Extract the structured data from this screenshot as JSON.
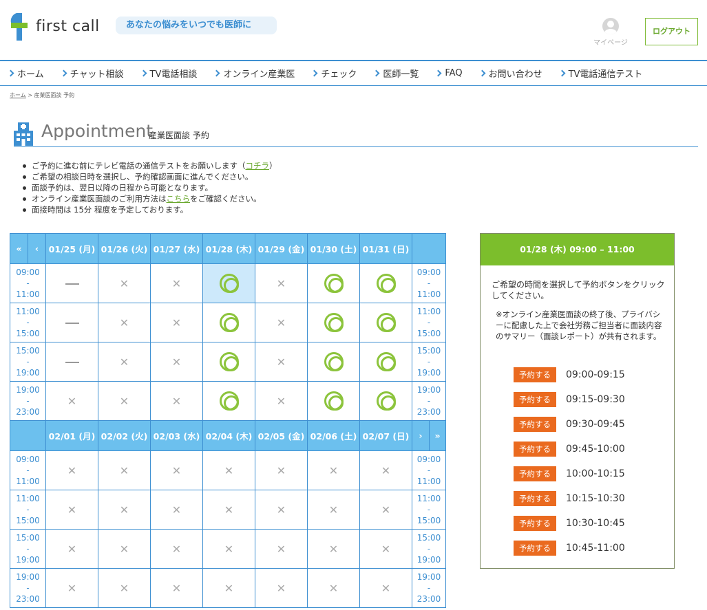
{
  "header": {
    "logo_text": "first call",
    "tagline": "あなたの悩みをいつでも医師に",
    "mypage_label": "マイページ",
    "logout_label": "ログアウト"
  },
  "nav": [
    "ホーム",
    "チャット相談",
    "TV電話相談",
    "オンライン産業医",
    "チェック",
    "医師一覧",
    "FAQ",
    "お問い合わせ",
    "TV電話通信テスト"
  ],
  "breadcrumb": {
    "home": "ホーム",
    "sep": ">",
    "current": "産業医面談 予約"
  },
  "title": {
    "en": "Appointment",
    "jp": "産業医面談 予約"
  },
  "notes": [
    {
      "text": "ご予約に進む前にテレビ電話の通信テストをお願いします（",
      "link": "コチラ",
      "after": "）"
    },
    {
      "text": "ご希望の相談日時を選択し、予約確認画面に進んでください。",
      "link": "",
      "after": ""
    },
    {
      "text": "面談予約は、翌日以降の日程から可能となります。",
      "link": "",
      "after": ""
    },
    {
      "text": "オンライン産業医面談のご利用方法は",
      "link": "こちら",
      "after": "をご確認ください。"
    },
    {
      "text": "面接時間は 15分 程度を予定しております。",
      "link": "",
      "after": ""
    }
  ],
  "calendar": {
    "nav": {
      "first": "«",
      "prev": "‹",
      "next": "›",
      "last": "»"
    },
    "time_slots": [
      [
        "09:00",
        "-",
        "11:00"
      ],
      [
        "11:00",
        "-",
        "15:00"
      ],
      [
        "15:00",
        "-",
        "19:00"
      ],
      [
        "19:00",
        "-",
        "23:00"
      ]
    ],
    "weeks": [
      {
        "days": [
          "01/25 (月)",
          "01/26 (火)",
          "01/27 (水)",
          "01/28 (木)",
          "01/29 (金)",
          "01/30 (土)",
          "01/31 (日)"
        ],
        "rows": [
          [
            "dash",
            "x",
            "x",
            "o",
            "x",
            "o",
            "o"
          ],
          [
            "dash",
            "x",
            "x",
            "o",
            "x",
            "o",
            "o"
          ],
          [
            "dash",
            "x",
            "x",
            "o",
            "x",
            "o",
            "o"
          ],
          [
            "x",
            "x",
            "x",
            "o",
            "x",
            "o",
            "o"
          ]
        ]
      },
      {
        "days": [
          "02/01 (月)",
          "02/02 (火)",
          "02/03 (水)",
          "02/04 (木)",
          "02/05 (金)",
          "02/06 (土)",
          "02/07 (日)"
        ],
        "rows": [
          [
            "x",
            "x",
            "x",
            "x",
            "x",
            "x",
            "x"
          ],
          [
            "x",
            "x",
            "x",
            "x",
            "x",
            "x",
            "x"
          ],
          [
            "x",
            "x",
            "x",
            "x",
            "x",
            "x",
            "x"
          ],
          [
            "x",
            "x",
            "x",
            "x",
            "x",
            "x",
            "x"
          ]
        ]
      }
    ],
    "selected": {
      "week": 0,
      "row": 0,
      "col": 3
    }
  },
  "panel": {
    "heading": "01/28 (木)  09:00 – 11:00",
    "intro": "ご希望の時間を選択して予約ボタンをクリックしてください。",
    "note": "※オンライン産業医面談の終了後、プライバシーに配慮した上で会社労務ご担当者に面談内容のサマリー（面談レポート）が共有されます。",
    "button_label": "予約する",
    "slots": [
      "09:00-09:15",
      "09:15-09:30",
      "09:30-09:45",
      "09:45-10:00",
      "10:00-10:15",
      "10:15-10:30",
      "10:30-10:45",
      "10:45-11:00"
    ]
  },
  "colors": {
    "accent_blue": "#3d8fd1",
    "header_blue": "#6cc0ee",
    "green": "#7cbe2c",
    "orange": "#ea6a1f"
  }
}
